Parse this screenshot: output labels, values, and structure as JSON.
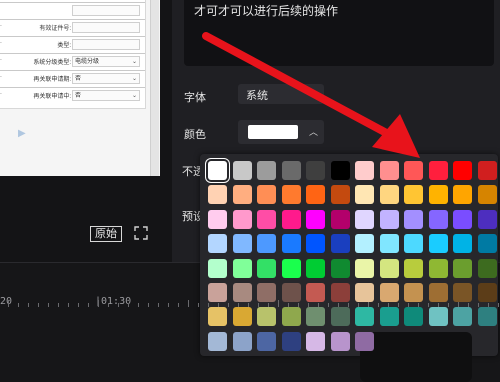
{
  "document_preview": {
    "rows": [
      {
        "label": "",
        "value": ""
      },
      {
        "label": "有效证件号:",
        "value": ""
      },
      {
        "label": "类型:",
        "value": ""
      },
      {
        "label": "系统分级类型:",
        "value": "电缆分级"
      },
      {
        "label": "再关联申请期:",
        "value": "否"
      },
      {
        "label": "再关联申请中:",
        "value": "否"
      }
    ]
  },
  "preview": {
    "original_label": "原始"
  },
  "text_panel": {
    "content": "才可才可以进行后续的操作"
  },
  "properties": {
    "font_label": "字体",
    "font_value": "系统",
    "color_label": "颜色",
    "color_value": "#ffffff",
    "partial_label_1": "不透",
    "partial_label_2": "预设"
  },
  "timeline": {
    "labels": [
      "20",
      "|01:30"
    ]
  },
  "palette": {
    "selected": "#ffffff",
    "rows": [
      [
        "#ffffff",
        "#c8c8c8",
        "#9c9c9c",
        "#6a6a6a",
        "#3f3f3f",
        "#000000",
        "#ffcccc",
        "#ff8f8f",
        "#ff5757",
        "#ff1f3d",
        "#ff0000",
        "#d11f1f"
      ],
      [
        "#ffd2b3",
        "#ffae80",
        "#ff8e55",
        "#ff7a2e",
        "#ff6414",
        "#c44a0f",
        "#ffe6b3",
        "#ffd680",
        "#ffc533",
        "#ffb300",
        "#ffa500",
        "#d68400"
      ],
      [
        "#ffccee",
        "#ff99cc",
        "#ff4da6",
        "#ff1a8c",
        "#ff00ff",
        "#b3006b",
        "#e0d6ff",
        "#c2b3ff",
        "#a38fff",
        "#8566ff",
        "#7a4dff",
        "#4d2ebf"
      ],
      [
        "#b3d6ff",
        "#80b8ff",
        "#4d99ff",
        "#1a7aff",
        "#0055ff",
        "#1a3fbf",
        "#b3f0ff",
        "#80e6ff",
        "#4dd9ff",
        "#1accff",
        "#00b3e6",
        "#007aa3"
      ],
      [
        "#b3ffcc",
        "#80ff99",
        "#33e066",
        "#1aff4d",
        "#00cc33",
        "#108a30",
        "#eaf5a8",
        "#d4e680",
        "#b8cc3d",
        "#8fb833",
        "#6b9e2e",
        "#3d6b1f"
      ],
      [
        "#c9a29a",
        "#a88a80",
        "#8f6e66",
        "#6e524b",
        "#c45a52",
        "#8c3f3a",
        "#e7c49a",
        "#d9a870",
        "#c49250",
        "#9e6e33",
        "#7a5526",
        "#5c3d18"
      ],
      [
        "#e6c266",
        "#d9a833",
        "#b8c26b",
        "#8fa84d",
        "#6f8f6f",
        "#4d6b5a",
        "#2eb8a3",
        "#1a9e8f",
        "#0f8a7a",
        "#6fc2c2",
        "#4da3a3",
        "#2e8080"
      ],
      [
        "#a3b8d6",
        "#8ca3c9",
        "#4d66a3",
        "#2e4080",
        "#d6b8e6",
        "#b894cc",
        "#8f6ba3",
        "",
        "",
        "",
        "",
        ""
      ]
    ]
  }
}
